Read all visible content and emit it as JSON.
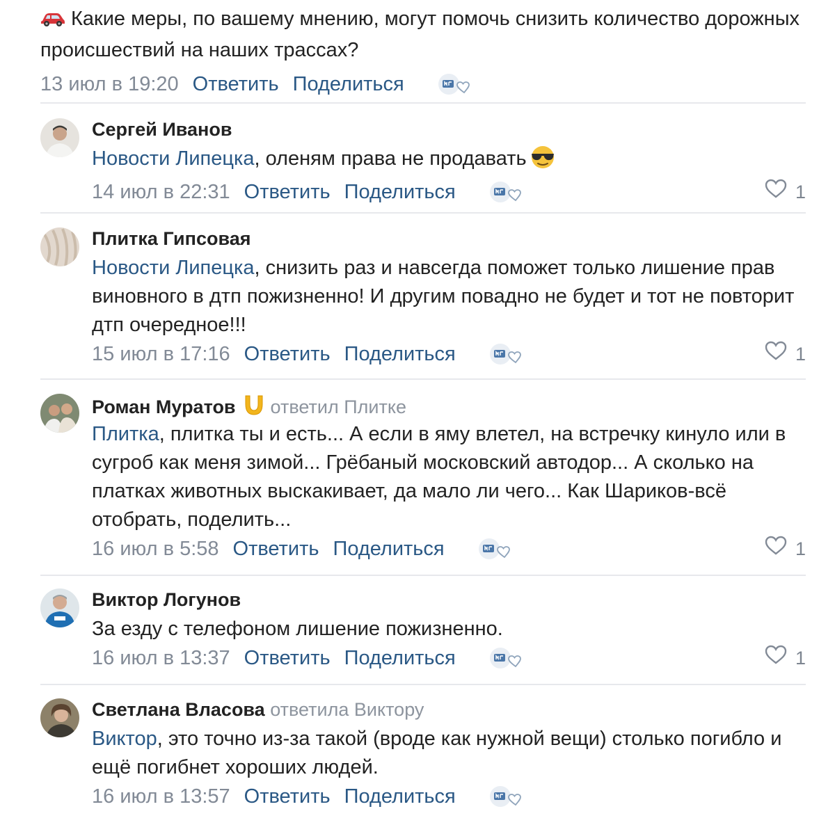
{
  "post": {
    "icon": "car-icon",
    "text": "Какие меры, по вашему мнению, могут помочь снизить количество дорожных происшествий на наших трассах?",
    "date": "13 июл в 19:20",
    "reply": "Ответить",
    "share": "Поделиться"
  },
  "comments": [
    {
      "author": "Сергей Иванов",
      "mention": "Новости Липецка",
      "text": ", оленям права не продавать",
      "emoji": "sunglasses-emoji",
      "date": "14 июл в 22:31",
      "reply": "Ответить",
      "share": "Поделиться",
      "likes": "1"
    },
    {
      "author": "Плитка Гипсовая",
      "mention": "Новости Липецка",
      "text": ", снизить раз и навсегда поможет только лишение прав виновного в дтп пожизненно! И другим повадно не будет и тот не повторит дтп очередное!!!",
      "date": "15 июл в 17:16",
      "reply": "Ответить",
      "share": "Поделиться",
      "likes": "1"
    },
    {
      "author": "Роман Муратов",
      "badge": "horseshoe-icon",
      "replied_prefix": "ответил",
      "replied_to": "Плитке",
      "mention": "Плитка",
      "text": ", плитка ты и есть... А если в яму влетел, на встречку кинуло или в сугроб как меня зимой... Грёбаный московский автодор... А сколько на платках животных выскакивает, да мало ли чего... Как Шариков-всё отобрать, поделить...",
      "date": "16 июл в 5:58",
      "reply": "Ответить",
      "share": "Поделиться",
      "likes": "1"
    },
    {
      "author": "Виктор Логунов",
      "text": "За езду с телефоном лишение пожизненно.",
      "date": "16 июл в 13:37",
      "reply": "Ответить",
      "share": "Поделиться",
      "likes": "1"
    },
    {
      "author": "Светлана Власова",
      "replied_prefix": "ответила",
      "replied_to": "Виктору",
      "mention": "Виктор",
      "text": ", это точно из-за такой (вроде как нужной вещи) столько погибло и ещё погибнет хороших людей.",
      "date": "16 июл в 13:57",
      "reply": "Ответить",
      "share": "Поделиться"
    }
  ],
  "colors": {
    "link": "#2a5885",
    "meta": "#828a96",
    "separator": "#e7e8ec",
    "text": "#222222"
  }
}
